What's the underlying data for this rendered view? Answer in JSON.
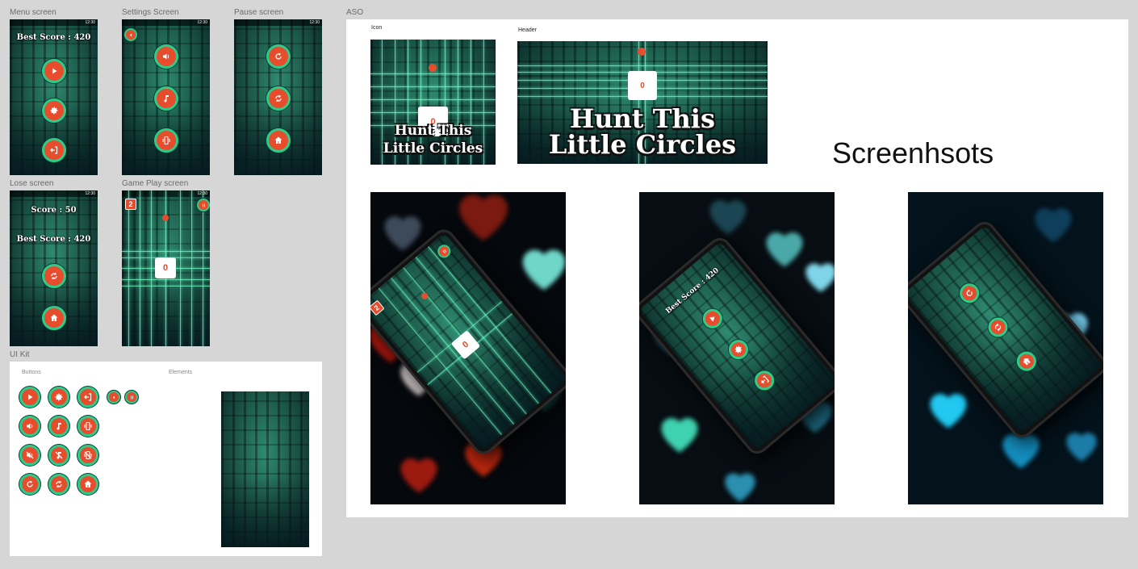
{
  "labels": {
    "menu": "Menu screen",
    "settings": "Settings Screen",
    "pause": "Pause screen",
    "lose": "Lose screen",
    "gameplay": "Game Play screen",
    "uikit": "UI Kit",
    "aso": "ASO",
    "buttons": "Buttons",
    "elements": "Elements",
    "icon": "Icon",
    "header": "Header",
    "screenshots": "Screenhsots"
  },
  "menu_screen": {
    "best_score": "Best Score : 420"
  },
  "lose_screen": {
    "score": "Score : 50",
    "best_score": "Best Score : 420"
  },
  "gameplay_screen": {
    "level": "2",
    "board_value": "0"
  },
  "icon_art": {
    "title_line1": "Hunt This",
    "title_line2": "Little Circles",
    "board_value": "0"
  },
  "header_art": {
    "title_line1": "Hunt This",
    "title_line2": "Little Circles",
    "board_value": "0"
  },
  "screenshot1": {
    "level": "2",
    "board_value": "0"
  },
  "screenshot2": {
    "best_score": "Best Score : 420"
  },
  "status_time": "12:30",
  "colors": {
    "accent": "#e74c2c",
    "ring": "#2ecc8a",
    "canvas": "#d6d6d6"
  },
  "icons": [
    "play-icon",
    "gear-icon",
    "exit-icon",
    "back-icon",
    "pause-icon",
    "sound-icon",
    "music-icon",
    "vibrate-icon",
    "sound-off-icon",
    "music-off-icon",
    "vibrate-off-icon",
    "restart-icon",
    "reload-icon",
    "home-icon"
  ]
}
